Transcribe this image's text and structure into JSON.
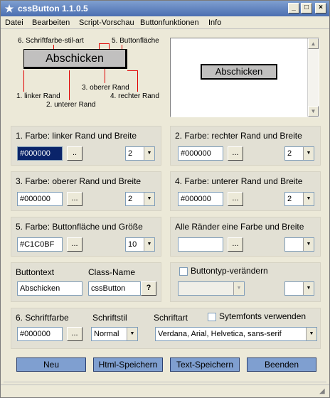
{
  "window": {
    "title": "cssButton 1.1.0.5",
    "icon": "star-icon",
    "controls": {
      "minimize": "_",
      "maximize": "□",
      "close": "×"
    }
  },
  "menu": [
    "Datei",
    "Bearbeiten",
    "Script-Vorschau",
    "Buttonfunktionen",
    "Info"
  ],
  "diagram": {
    "button_text": "Abschicken",
    "labels": {
      "font_color": "6. Schriftfarbe-stil-art",
      "button_face": "5. Buttonfläche",
      "left_border": "1. linker Rand",
      "bottom_border": "2. unterer Rand",
      "top_border": "3. oberer Rand",
      "right_border": "4. rechter Rand"
    }
  },
  "preview": {
    "button_text": "Abschicken"
  },
  "panels": {
    "left_border": {
      "title": "1. Farbe: linker Rand und Breite",
      "color": "#000000",
      "width": "2"
    },
    "right_border": {
      "title": "2. Farbe: rechter Rand und Breite",
      "color": "#000000",
      "width": "2"
    },
    "top_border": {
      "title": "3. Farbe: oberer Rand und Breite",
      "color": "#000000",
      "width": "2"
    },
    "bottom_border": {
      "title": "4. Farbe: unterer Rand und Breite",
      "color": "#000000",
      "width": "2"
    },
    "face": {
      "title": "5. Farbe: Buttonfläche und Größe",
      "color": "#C1C0BF",
      "size": "10"
    },
    "all_borders": {
      "title": "Alle Ränder eine Farbe und Breite",
      "color": "",
      "width": ""
    },
    "button_text": {
      "title": "Buttontext",
      "value": "Abschicken"
    },
    "class_name": {
      "title": "Class-Name",
      "value": "cssButton",
      "help": "?"
    },
    "type_change": {
      "title": "Buttontyp-verändern",
      "checked": false
    },
    "font": {
      "color_title": "6. Schriftfarbe",
      "color": "#000000",
      "style_title": "Schriftstil",
      "style": "Normal",
      "family_title": "Schriftart",
      "family": "Verdana, Arial, Helvetica, sans-serif",
      "system_fonts_label": "Sytemfonts verwenden",
      "system_fonts_checked": false
    }
  },
  "dots_label": "...",
  "dots_label_short": "..",
  "actions": {
    "new": "Neu",
    "html_save": "Html-Speichern",
    "text_save": "Text-Speichern",
    "quit": "Beenden"
  },
  "colors": {
    "accent": "#7f9fd0",
    "face": "#c1c0bf",
    "selection": "#0a246a",
    "line": "#e00000"
  }
}
